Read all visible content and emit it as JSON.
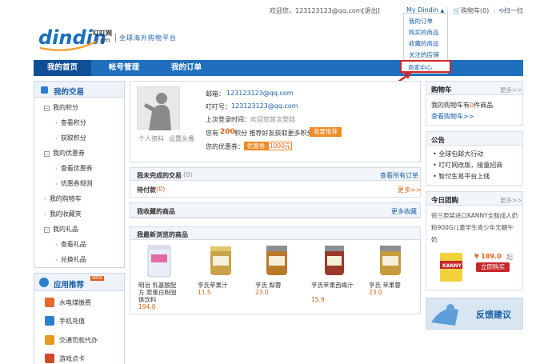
{
  "topbar": {
    "welcome": "欢迎您，123123123@qq.com[退出]",
    "account_menu": "My Dindin",
    "cart": "购物车(0)",
    "scan": "扫一扫"
  },
  "account_dropdown": {
    "items": [
      "我的订单",
      "购买的商品",
      "收藏的商品",
      "关注的店铺",
      "商家中心"
    ]
  },
  "logo": {
    "wordmark": "dindin",
    "cn_name": "叮叮网",
    "domain": ".com",
    "slogan": "全球海外购物平台"
  },
  "nav": {
    "home": "我的首页",
    "account": "帐号管理",
    "orders": "我的订单"
  },
  "sidebar": {
    "section1_title": "我的交易",
    "tree": [
      {
        "label": "我的积分",
        "type": "group"
      },
      {
        "label": "查看积分",
        "type": "child"
      },
      {
        "label": "获取积分",
        "type": "child"
      },
      {
        "label": "我的优惠券",
        "type": "group"
      },
      {
        "label": "查看优惠券",
        "type": "child"
      },
      {
        "label": "优惠券规则",
        "type": "child"
      },
      {
        "label": "我的购物车",
        "type": "link"
      },
      {
        "label": "我的收藏夹",
        "type": "link"
      },
      {
        "label": "我的礼品",
        "type": "group"
      },
      {
        "label": "查看礼品",
        "type": "child"
      },
      {
        "label": "兑换礼品",
        "type": "child"
      }
    ],
    "section2_title": "应用推荐",
    "section2_badge": "NEW",
    "apps": [
      "水电煤缴费",
      "手机充值",
      "交通罚款代办",
      "游戏点卡"
    ]
  },
  "profile": {
    "avatar_links": [
      "个人资料",
      "设置头像"
    ],
    "email_label": "邮箱：",
    "email": "123123123@qq.com",
    "dindin_label": "叮叮号：",
    "dindin_id": "123123123@qq.com",
    "last_login_label": "上次登录时间：",
    "last_login": "欢迎您首次登陆",
    "points_prefix": "您有",
    "points": "200",
    "points_suffix": "积分 推荐好友获取更多积分",
    "recommend_button": "我要推荐",
    "coupon_label": "您的优惠券：",
    "coupon_badge": "优惠券",
    "coupon_value": "1000元"
  },
  "unfinished_orders": {
    "title": "我未完成的交易",
    "count": "(0)",
    "view_all": "查看所有订单",
    "pending_label": "待付款",
    "pending_count": "(0)",
    "more": "更多>>"
  },
  "favorites": {
    "title": "我收藏的商品",
    "more": "更多收藏"
  },
  "recent": {
    "title": "我最新浏览的商品",
    "products": [
      {
        "name": "明治 乳基酸配方 原蛋白粉固体饮料",
        "price": "194.0",
        "color": "#e8eef6"
      },
      {
        "name": "亨氏苹果汁",
        "price": "11.5",
        "color": "#c9a24a"
      },
      {
        "name": "亨氏 梨蓉",
        "price": "23.0",
        "color": "#b87a2a"
      },
      {
        "name": "亨氏苹果西梅汁",
        "price": "15.9",
        "color": "#9b3a2a"
      },
      {
        "name": "亨氏 苹果蓉",
        "price": "23.0",
        "color": "#c79a3e"
      }
    ]
  },
  "cart_box": {
    "title": "购物车",
    "more": "更多>>",
    "text_prefix": "我的购物车有",
    "count": "0",
    "text_suffix": "件商品",
    "view_link": "查看购物车>>"
  },
  "notice": {
    "title": "公告",
    "items": [
      "全球包邮大行动",
      "叮叮网改版，接童招商",
      "智付生易平台上线"
    ]
  },
  "group_buy": {
    "title": "今日团购",
    "more": "更多>>",
    "desc": "荷兰原装进口KANNY全脂成人奶粉900G儿童学生青少年无糖牛奶",
    "price_label": "¥ 189.0",
    "unit": "起",
    "buy_button": "立即购买"
  },
  "feedback": {
    "label": "反馈建议"
  },
  "colors": {
    "nav_blue": "#1f6fbe",
    "nav_dark": "#0e4f96",
    "link_blue": "#1a5fa8",
    "accent_orange": "#f08a24",
    "highlight_red": "#d0282b"
  }
}
